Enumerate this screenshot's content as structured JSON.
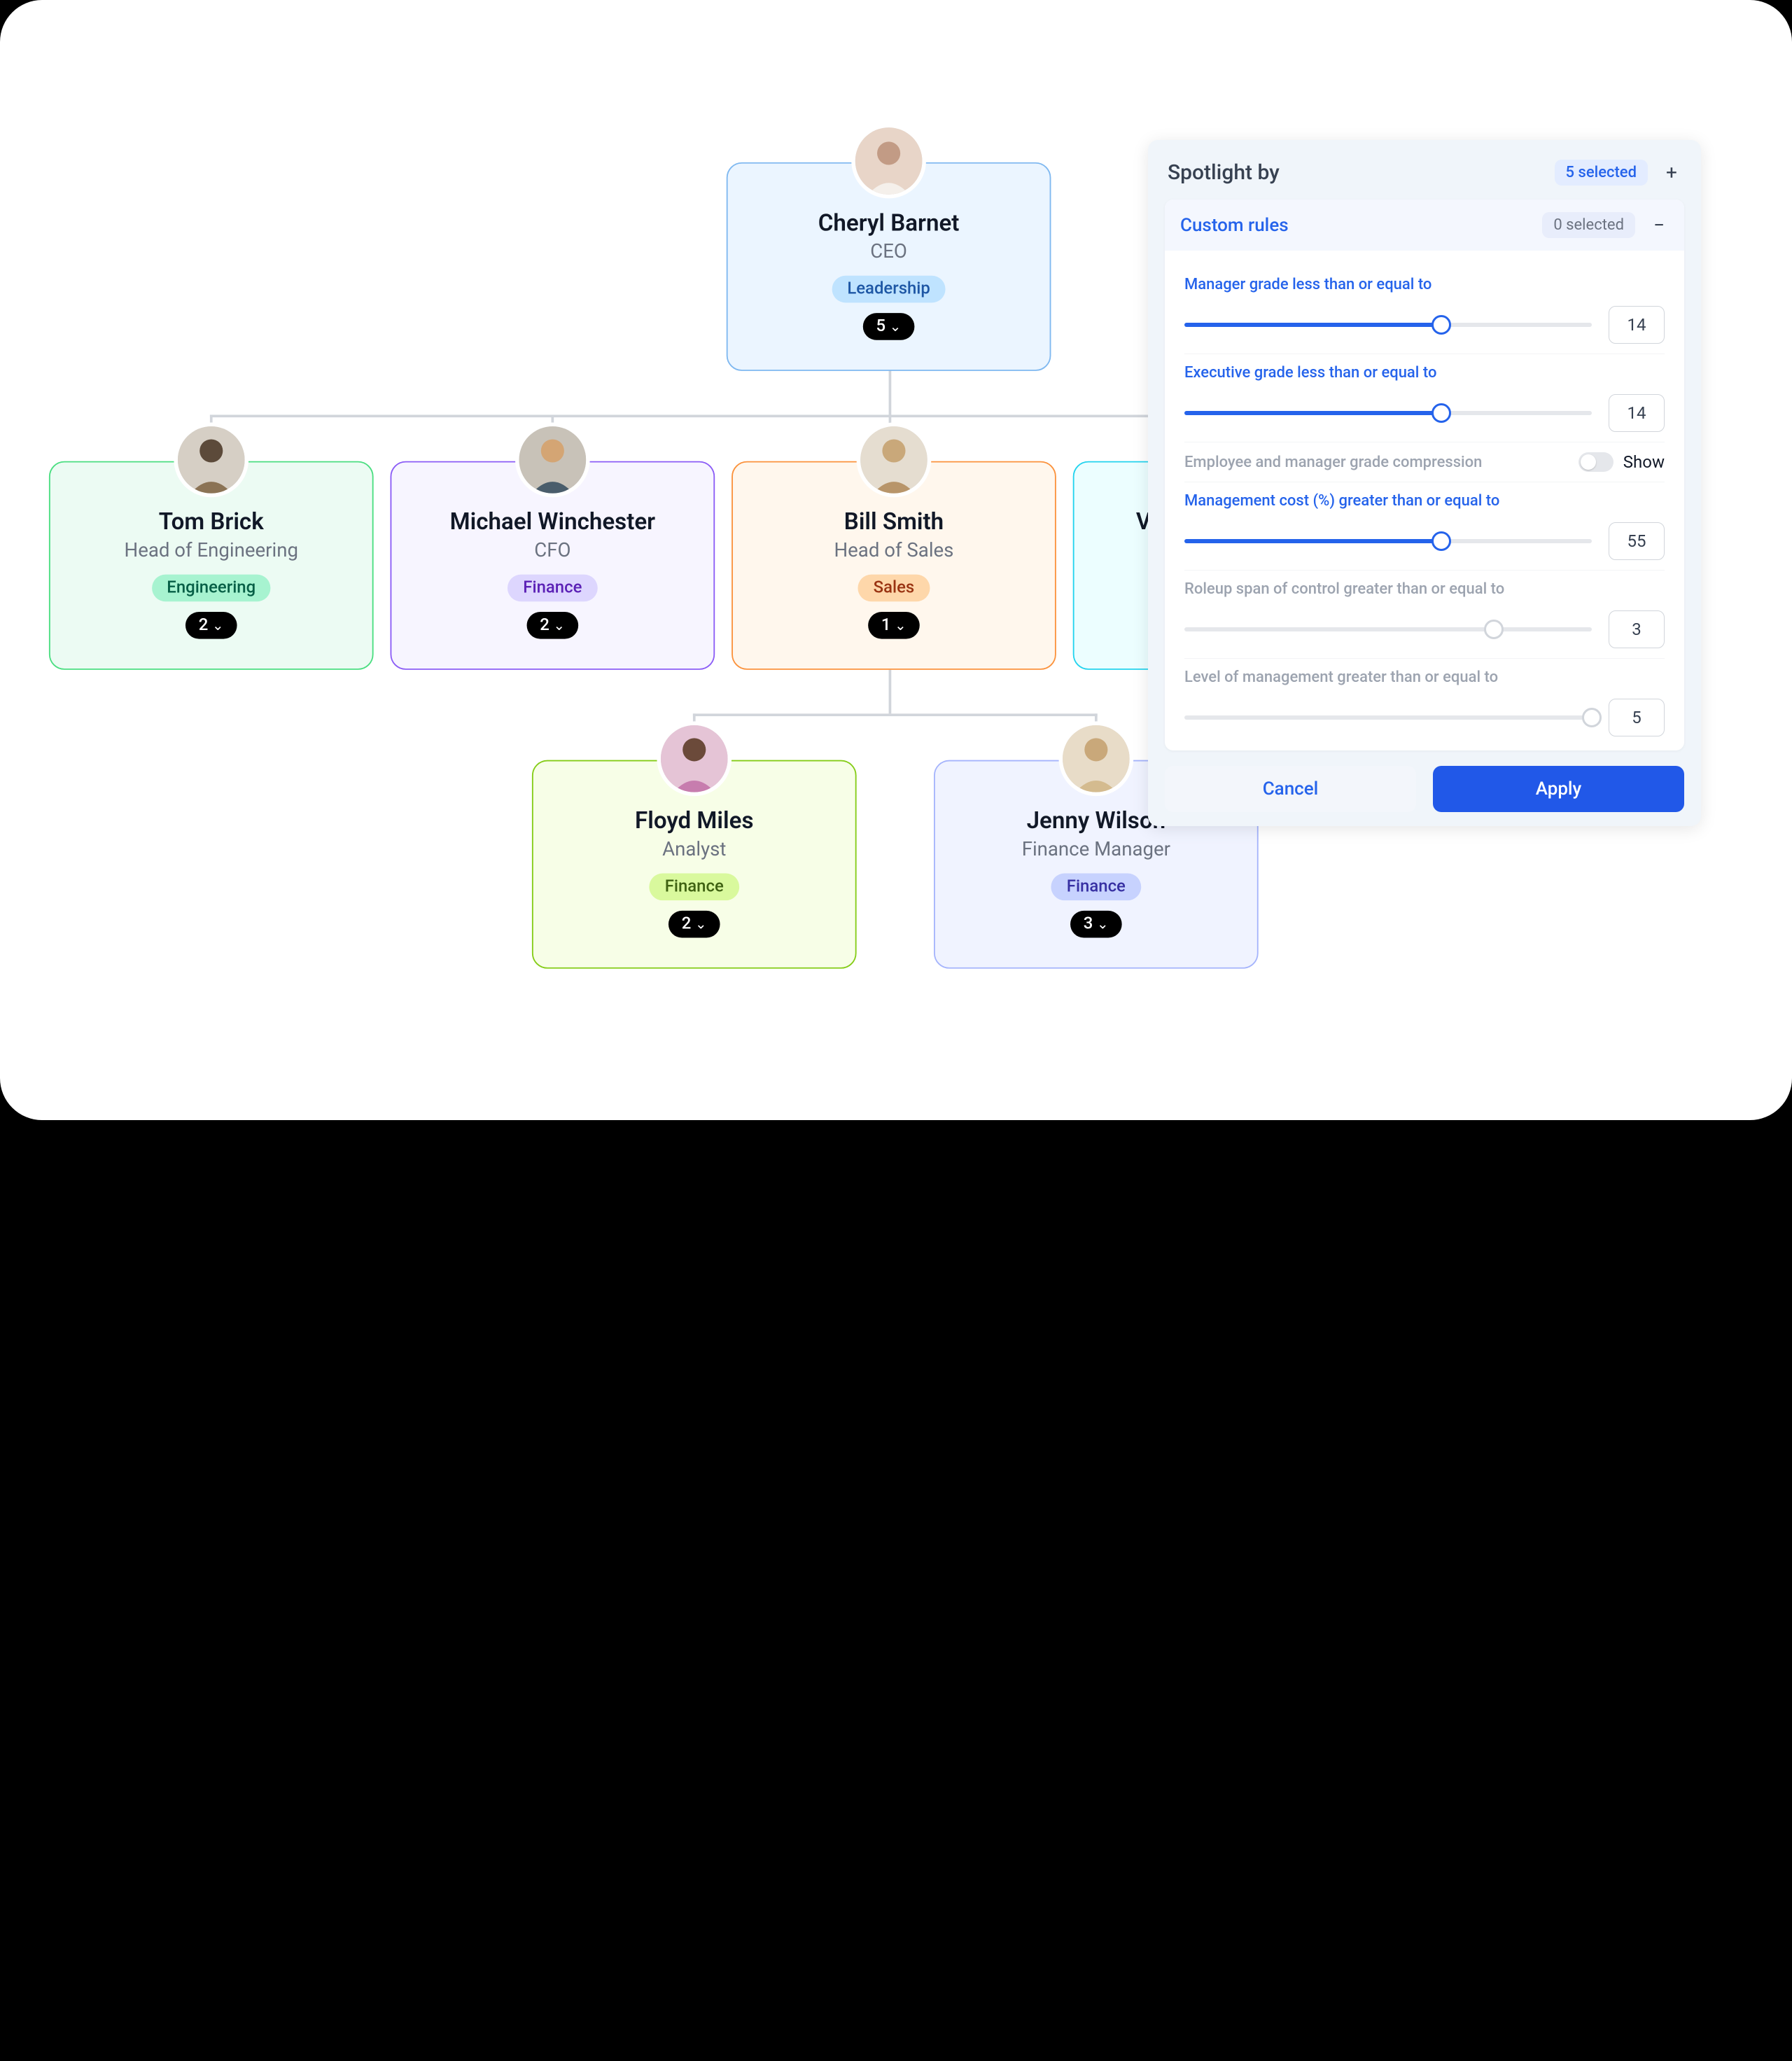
{
  "org": {
    "ceo": {
      "name": "Cheryl Barnet",
      "role": "CEO",
      "tag": "Leadership",
      "count": "5"
    },
    "reports": [
      {
        "name": "Tom Brick",
        "role": "Head of Engineering",
        "tag": "Engineering",
        "count": "2"
      },
      {
        "name": "Michael Winchester",
        "role": "CFO",
        "tag": "Finance",
        "count": "2"
      },
      {
        "name": "Bill Smith",
        "role": "Head of Sales",
        "tag": "Sales",
        "count": "1"
      },
      {
        "name_partial": "V",
        "role": "",
        "tag": "",
        "count": ""
      }
    ],
    "level3": [
      {
        "name": "Floyd Miles",
        "role": "Analyst",
        "tag": "Finance",
        "count": "2"
      },
      {
        "name": "Jenny Wilson",
        "role": "Finance Manager",
        "tag": "Finance",
        "count": "3"
      }
    ]
  },
  "panel": {
    "spotlight_title": "Spotlight by",
    "spotlight_selected": "5 selected",
    "custom_title": "Custom rules",
    "custom_selected": "0 selected",
    "rules": [
      {
        "label": "Manager grade less than or equal to",
        "value": "14",
        "fill": 63,
        "active": true
      },
      {
        "label": "Executive grade less than or equal to",
        "value": "14",
        "fill": 63,
        "active": true
      },
      {
        "label": "Employee and manager grade compression",
        "value": "Show",
        "toggle": true
      },
      {
        "label": "Management cost (%) greater than or equal to",
        "value": "55",
        "fill": 63,
        "active": true
      },
      {
        "label": "Roleup span of control greater than or equal to",
        "value": "3",
        "fill": 76,
        "active": false
      },
      {
        "label": "Level of management greater than or equal to",
        "value": "5",
        "fill": 100,
        "active": false
      }
    ],
    "cancel": "Cancel",
    "apply": "Apply"
  }
}
